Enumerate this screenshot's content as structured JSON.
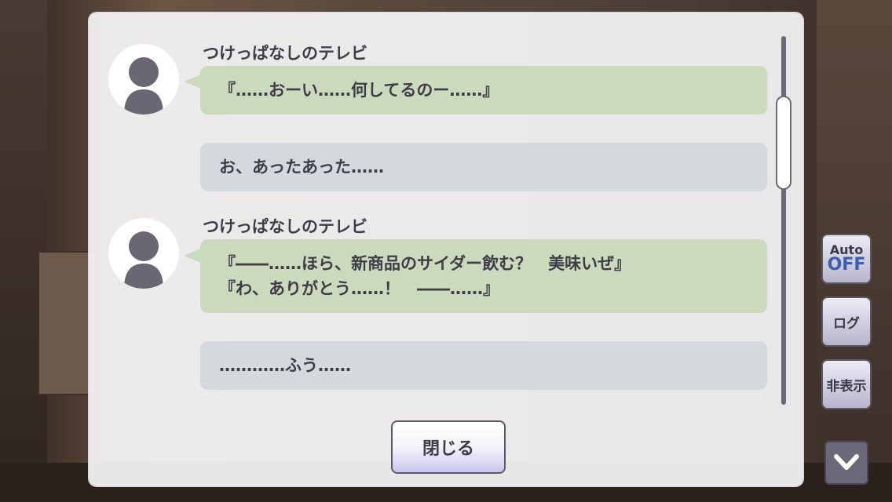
{
  "backlog": {
    "entries": [
      {
        "speaker": "つけっぱなしのテレビ",
        "lines": [
          "『……おーい……何してるのー……』"
        ],
        "style": "green"
      },
      {
        "speaker": "",
        "lines": [
          "お、あったあった……"
        ],
        "style": "grey"
      },
      {
        "speaker": "つけっぱなしのテレビ",
        "lines": [
          "『――……ほら、新商品のサイダー飲む？　美味いぜ』",
          "『わ、ありがとう……！　――……』"
        ],
        "style": "green"
      },
      {
        "speaker": "",
        "lines": [
          "…………ふう……"
        ],
        "style": "grey"
      }
    ],
    "close_label": "閉じる"
  },
  "side_controls": {
    "auto_label": "Auto",
    "auto_state": "OFF",
    "log_label": "ログ",
    "hide_label": "非表示"
  },
  "colors": {
    "speech_green": "#cbdabc",
    "narration_grey": "#d4d9de",
    "text": "#3f3c48",
    "auto_off_blue": "#3a5fb0"
  },
  "icons": [
    "avatar-silhouette-icon",
    "chevron-down-icon"
  ]
}
